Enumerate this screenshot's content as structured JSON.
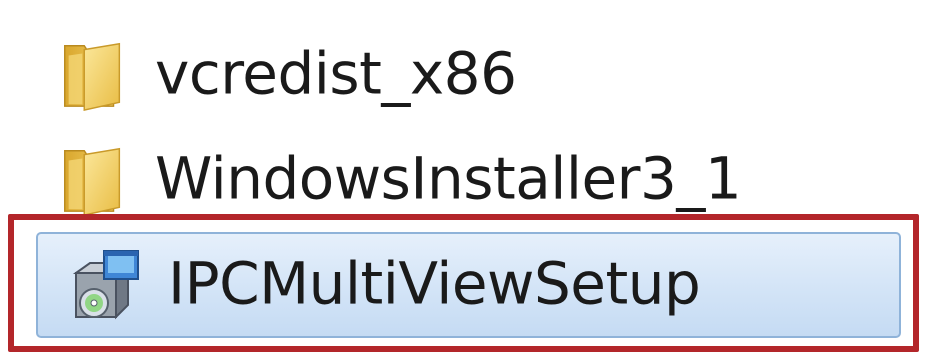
{
  "items": [
    {
      "name": "vcredist_x86",
      "icon": "folder-icon"
    },
    {
      "name": "WindowsInstaller3_1",
      "icon": "folder-icon"
    },
    {
      "name": "IPCMultiViewSetup",
      "icon": "setup-installer-icon",
      "selected": true
    }
  ],
  "colors": {
    "highlight_border": "#b3262a",
    "selection_fill": "#d3e4f7",
    "selection_border": "#8fb3d9",
    "folder_yellow": "#f2cf5b"
  }
}
